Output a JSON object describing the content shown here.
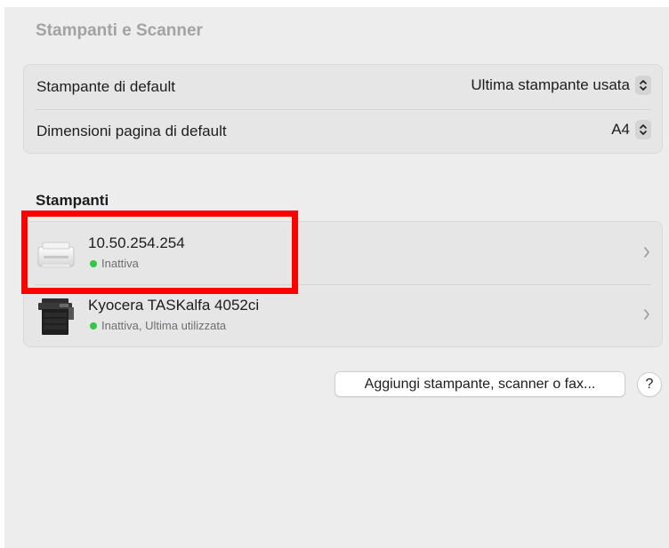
{
  "header": {
    "title": "Stampanti e Scanner"
  },
  "defaults": {
    "rows": [
      {
        "label": "Stampante di default",
        "value": "Ultima stampante usata"
      },
      {
        "label": "Dimensioni pagina di default",
        "value": "A4"
      }
    ]
  },
  "printers": {
    "title": "Stampanti",
    "items": [
      {
        "name": "10.50.254.254",
        "status": "Inattiva",
        "icon": "desktop-printer-icon"
      },
      {
        "name": "Kyocera TASKalfa 4052ci",
        "status": "Inattiva, Ultima utilizzata",
        "icon": "multifunction-printer-icon"
      }
    ]
  },
  "actions": {
    "add_label": "Aggiungi stampante, scanner o fax...",
    "help_label": "?"
  },
  "colors": {
    "status_active": "#33c748",
    "highlight": "#ff0000"
  }
}
